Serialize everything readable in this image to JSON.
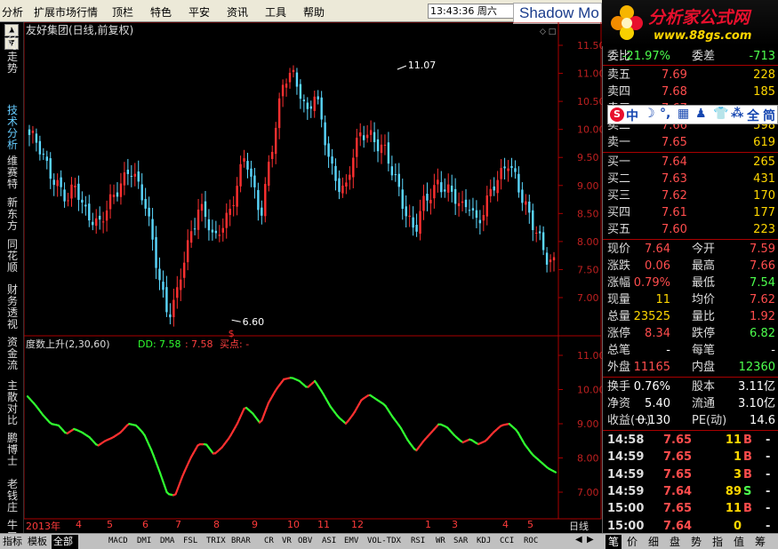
{
  "menu": [
    "分析",
    "扩展市场行情",
    "顶栏",
    "特色",
    "平安",
    "资讯",
    "工具",
    "帮助"
  ],
  "clock": "13:43:36 周六",
  "watermark_text": "Shadow Mo",
  "logo": {
    "name": "分析家公式网",
    "url": "www.88gs.com"
  },
  "sidebar_tabs": [
    "分时走势",
    "技术分析",
    "维赛特",
    "新东方",
    "同花顺",
    "财务透视",
    "资金流",
    "主散对比",
    "鹏博士",
    "老钱庄",
    "牛叉诊股"
  ],
  "sidebar_active": 1,
  "chart": {
    "title": "友好集团(日线,前复权)",
    "high_label": "11.07",
    "low_label": "6.60",
    "marker": "$",
    "indicator_name": "度数上升(2,30,60)",
    "indicator_dd_label": "DD:",
    "indicator_dd_value": "7.58",
    "indicator_sep": ":",
    "indicator_value2": "7.58",
    "indicator_buy": "买点: -",
    "price_ticks": [
      "11.50",
      "11.00",
      "10.50",
      "10.00",
      "9.50",
      "9.00",
      "8.50",
      "8.00",
      "7.50",
      "7.00"
    ],
    "ind_ticks": [
      "11.00",
      "10.00",
      "9.00",
      "8.00",
      "7.00"
    ],
    "time_labels": [
      "2013年",
      "4",
      "5",
      "6",
      "7",
      "8",
      "9",
      "10",
      "11",
      "12",
      "1",
      "3",
      "4",
      "5"
    ],
    "period": "日线"
  },
  "chart_data": {
    "type": "candlestick",
    "title": "友好集团(日线,前复权)",
    "price_ylim": [
      6.5,
      11.6
    ],
    "price_close_path": [
      9.9,
      9.7,
      9.4,
      9.2,
      9.0,
      8.7,
      8.95,
      8.6,
      8.5,
      8.3,
      8.5,
      8.8,
      9.1,
      9.4,
      9.0,
      8.6,
      8.0,
      7.3,
      6.7,
      6.9,
      7.6,
      8.2,
      8.7,
      8.4,
      7.9,
      8.3,
      8.6,
      9.1,
      9.5,
      8.9,
      8.5,
      9.4,
      10.1,
      10.8,
      11.0,
      10.8,
      10.3,
      10.6,
      10.0,
      9.4,
      9.1,
      8.9,
      9.5,
      9.9,
      10.0,
      9.8,
      9.6,
      9.2,
      8.9,
      8.5,
      8.2,
      8.6,
      8.8,
      9.1,
      9.0,
      8.8,
      8.5,
      8.7,
      8.4,
      8.6,
      8.9,
      9.1,
      9.5,
      9.2,
      8.7,
      8.3,
      8.1,
      7.8,
      7.64
    ],
    "indicator": {
      "name": "度数上升(2,30,60)",
      "ylim": [
        6.7,
        11.3
      ],
      "values": [
        9.8,
        9.55,
        9.25,
        9.0,
        8.95,
        8.7,
        8.85,
        8.75,
        8.6,
        8.35,
        8.5,
        8.6,
        8.75,
        9.0,
        8.95,
        8.7,
        8.2,
        7.6,
        6.95,
        6.9,
        7.5,
        8.0,
        8.4,
        8.4,
        8.1,
        8.3,
        8.6,
        9.0,
        9.5,
        9.3,
        9.0,
        9.6,
        10.0,
        10.3,
        10.35,
        10.25,
        10.05,
        10.25,
        9.9,
        9.5,
        9.2,
        9.0,
        9.3,
        9.7,
        9.85,
        9.7,
        9.55,
        9.2,
        8.9,
        8.5,
        8.2,
        8.5,
        8.75,
        9.0,
        8.9,
        8.65,
        8.45,
        8.55,
        8.4,
        8.5,
        8.75,
        8.95,
        9.0,
        8.8,
        8.4,
        8.1,
        7.9,
        7.7,
        7.58
      ],
      "rising_color": "#ff3030",
      "falling_color": "#30ff30"
    },
    "bull_color": "#ff3030",
    "bear_color": "#5bd8ff"
  },
  "toolbar": {
    "tabs": [
      "指标",
      "模板",
      "全部"
    ],
    "active": 2,
    "indicators": [
      "MACD",
      "DMI",
      "DMA",
      "FSL",
      "TRIX",
      "BRAR",
      "CR",
      "VR",
      "OBV",
      "ASI",
      "EMV",
      "VOL-TDX",
      "RSI",
      "WR",
      "SAR",
      "KDJ",
      "CCI",
      "ROC"
    ]
  },
  "quote": {
    "ratio": {
      "label": "委比",
      "value": "-21.97%",
      "label2": "委差",
      "value2": "-713"
    },
    "asks": [
      {
        "label": "卖五",
        "price": "7.69",
        "vol": "228"
      },
      {
        "label": "卖四",
        "price": "7.68",
        "vol": "185"
      },
      {
        "label": "卖三",
        "price": "7.67",
        "vol": ""
      },
      {
        "label": "卖二",
        "price": "7.66",
        "vol": "598"
      },
      {
        "label": "卖一",
        "price": "7.65",
        "vol": "619"
      }
    ],
    "bids": [
      {
        "label": "买一",
        "price": "7.64",
        "vol": "265"
      },
      {
        "label": "买二",
        "price": "7.63",
        "vol": "431"
      },
      {
        "label": "买三",
        "price": "7.62",
        "vol": "170"
      },
      {
        "label": "买四",
        "price": "7.61",
        "vol": "177"
      },
      {
        "label": "买五",
        "price": "7.60",
        "vol": "223"
      }
    ],
    "stats": [
      {
        "l1": "现价",
        "v1": "7.64",
        "c1": "red",
        "l2": "今开",
        "v2": "7.59",
        "c2": "red"
      },
      {
        "l1": "涨跌",
        "v1": "0.06",
        "c1": "red",
        "l2": "最高",
        "v2": "7.66",
        "c2": "red"
      },
      {
        "l1": "涨幅",
        "v1": "0.79%",
        "c1": "red",
        "l2": "最低",
        "v2": "7.54",
        "c2": "green"
      },
      {
        "l1": "现量",
        "v1": "11",
        "c1": "yellow",
        "l2": "均价",
        "v2": "7.62",
        "c2": "red"
      },
      {
        "l1": "总量",
        "v1": "23525",
        "c1": "yellow",
        "l2": "量比",
        "v2": "1.92",
        "c2": "red"
      },
      {
        "l1": "涨停",
        "v1": "8.34",
        "c1": "red",
        "l2": "跌停",
        "v2": "6.82",
        "c2": "green"
      },
      {
        "l1": "总笔",
        "v1": "-",
        "c1": "white",
        "l2": "每笔",
        "v2": "-",
        "c2": "white"
      },
      {
        "l1": "外盘",
        "v1": "11165",
        "c1": "red",
        "l2": "内盘",
        "v2": "12360",
        "c2": "green"
      }
    ],
    "fund": [
      {
        "l1": "换手",
        "v1": "0.76%",
        "l2": "股本",
        "v2": "3.11亿"
      },
      {
        "l1": "净资",
        "v1": "5.40",
        "l2": "流通",
        "v2": "3.10亿"
      },
      {
        "l1": "收益(一)",
        "v1": "0.130",
        "l2": "PE(动)",
        "v2": "14.6"
      }
    ],
    "ticks": [
      {
        "time": "14:58",
        "price": "7.65",
        "vol": "11",
        "bs": "B"
      },
      {
        "time": "14:59",
        "price": "7.65",
        "vol": "1",
        "bs": "B"
      },
      {
        "time": "14:59",
        "price": "7.65",
        "vol": "3",
        "bs": "B"
      },
      {
        "time": "14:59",
        "price": "7.64",
        "vol": "89",
        "bs": "S"
      },
      {
        "time": "15:00",
        "price": "7.65",
        "vol": "11",
        "bs": "B"
      },
      {
        "time": "15:00",
        "price": "7.64",
        "vol": "0",
        "bs": ""
      }
    ],
    "tick_dash": "-"
  },
  "ime": {
    "s": "S",
    "items": [
      "中",
      "☽",
      "°,",
      "▦",
      "♟",
      "👕",
      "⁂",
      "全",
      "简"
    ]
  },
  "right_tabs": [
    "笔",
    "价",
    "细",
    "盘",
    "势",
    "指",
    "值",
    "筹"
  ],
  "right_tabs_active": 0
}
